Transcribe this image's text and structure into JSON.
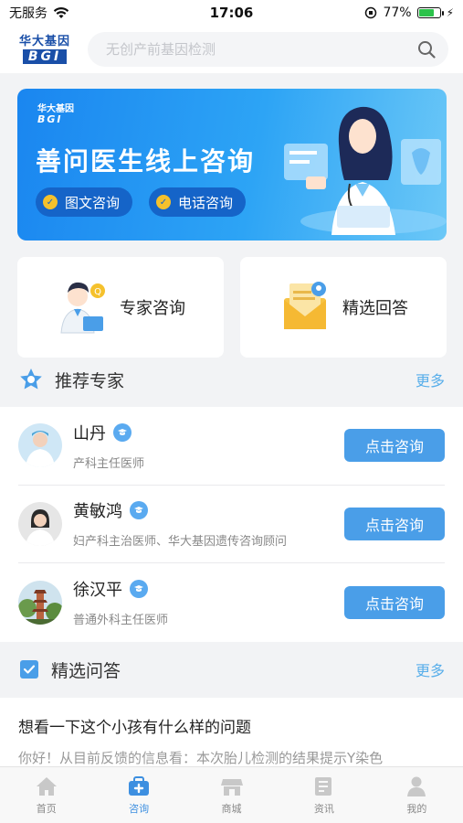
{
  "status_bar": {
    "carrier": "无服务",
    "time": "17:06",
    "battery": "77%",
    "battery_level": 0.77
  },
  "header": {
    "logo_cn": "华大基因",
    "logo_en": "BGI",
    "search_placeholder": "无创产前基因检测"
  },
  "banner": {
    "logo_cn": "华大基因",
    "logo_en": "BGI",
    "title": "善问医生线上咨询",
    "pills": [
      "图文咨询",
      "电话咨询"
    ]
  },
  "cards": [
    {
      "label": "专家咨询",
      "icon": "doctor-consult-icon"
    },
    {
      "label": "精选回答",
      "icon": "envelope-answer-icon"
    }
  ],
  "recommended": {
    "title": "推荐专家",
    "more": "更多",
    "experts": [
      {
        "name": "山丹",
        "title": "产科主任医师",
        "button": "点击咨询"
      },
      {
        "name": "黄敏鸿",
        "title": "妇产科主治医师、华大基因遗传咨询顾问",
        "button": "点击咨询"
      },
      {
        "name": "徐汉平",
        "title": "普通外科主任医师",
        "button": "点击咨询"
      }
    ]
  },
  "selected_qa": {
    "title": "精选问答",
    "more": "更多",
    "question": "想看一下这个小孩有什么样的问题",
    "answer": "你好！从目前反馈的信息看：本次胎儿检测的结果提示Y染色"
  },
  "tabbar": [
    {
      "label": "首页",
      "icon": "home-icon",
      "active": false
    },
    {
      "label": "咨询",
      "icon": "consult-icon",
      "active": true
    },
    {
      "label": "商城",
      "icon": "store-icon",
      "active": false
    },
    {
      "label": "资讯",
      "icon": "news-icon",
      "active": false
    },
    {
      "label": "我的",
      "icon": "profile-icon",
      "active": false
    }
  ],
  "colors": {
    "accent": "#4a9ee8",
    "banner": "#1a86f0",
    "brand": "#1a4fa8",
    "tab_active": "#3d8fe0"
  }
}
